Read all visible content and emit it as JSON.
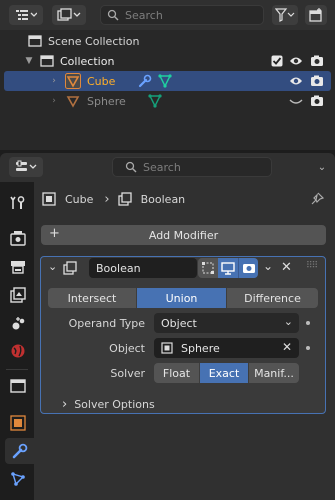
{
  "outliner": {
    "search_placeholder": "Search",
    "scene_collection": "Scene Collection",
    "collection": "Collection",
    "objects": [
      {
        "name": "Cube",
        "selected": true
      },
      {
        "name": "Sphere",
        "selected": false
      }
    ]
  },
  "properties": {
    "search_placeholder": "Search",
    "breadcrumb": {
      "object": "Cube",
      "modifier": "Boolean"
    },
    "add_modifier": "Add Modifier",
    "modifier": {
      "name": "Boolean",
      "operations": [
        "Intersect",
        "Union",
        "Difference"
      ],
      "active_operation": "Union",
      "operand_type_label": "Operand Type",
      "operand_type_value": "Object",
      "object_label": "Object",
      "object_value": "Sphere",
      "solver_label": "Solver",
      "solvers": [
        "Float",
        "Exact",
        "Manif..."
      ],
      "active_solver": "Exact",
      "solver_options": "Solver Options"
    }
  },
  "colors": {
    "accent": "#4772b3",
    "selected_row": "#334d80",
    "mesh_orange": "#e0883c",
    "mesh_green": "#1fd0a0",
    "modifier_blue": "#6aa2ff"
  }
}
